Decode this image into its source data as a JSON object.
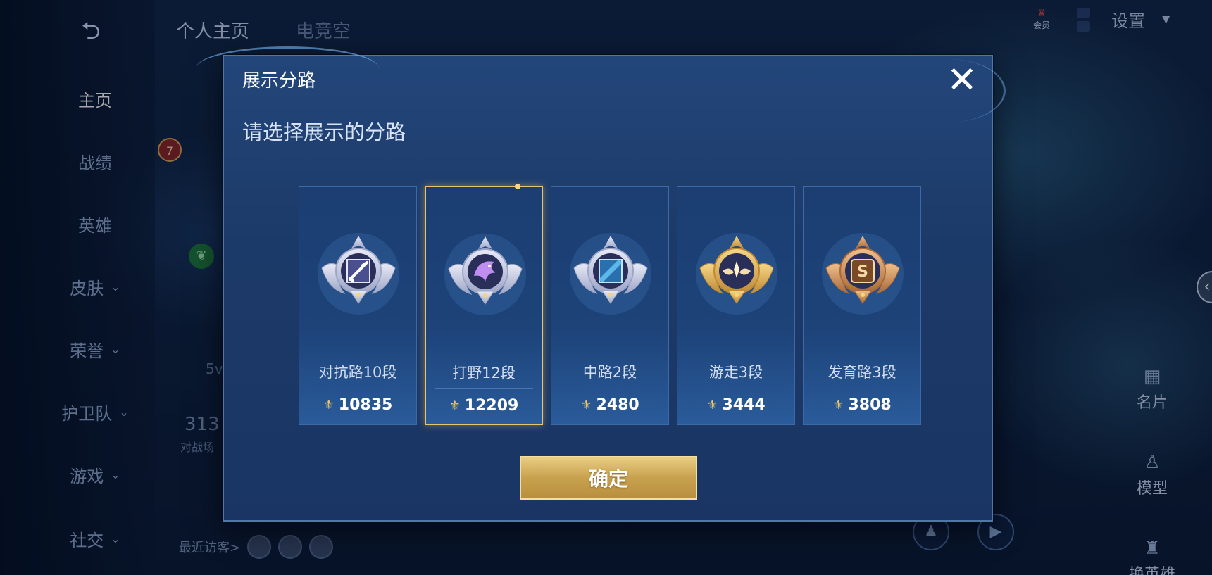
{
  "background": {
    "back_icon": "back-arrow-icon",
    "tabs": [
      "个人主页",
      "电竞空"
    ],
    "nav": [
      {
        "label": "主页",
        "has_chevron": false,
        "active": true
      },
      {
        "label": "战绩",
        "has_chevron": false
      },
      {
        "label": "英雄",
        "has_chevron": false
      },
      {
        "label": "皮肤",
        "has_chevron": true
      },
      {
        "label": "荣誉",
        "has_chevron": true
      },
      {
        "label": "护卫队",
        "has_chevron": true
      },
      {
        "label": "游戏",
        "has_chevron": true
      },
      {
        "label": "社交",
        "has_chevron": true
      }
    ],
    "member_label": "会员",
    "level_badge": "7",
    "mode_text": "5v",
    "match_count": "313",
    "match_label": "对战场",
    "settings_label": "设置",
    "visitors_label": "最近访客>",
    "right_tools": [
      "名片",
      "模型",
      "换英雄"
    ]
  },
  "dialog": {
    "title": "展示分路",
    "subtitle": "请选择展示的分路",
    "close_icon": "close-icon",
    "confirm_label": "确定",
    "selected_index": 1,
    "lanes": [
      {
        "name": "对抗路10段",
        "score": "10835",
        "medal": "sword-medal",
        "tier": "silver",
        "accent": "#a9a7e6"
      },
      {
        "name": "打野12段",
        "score": "12209",
        "medal": "dragon-medal",
        "tier": "silver",
        "accent": "#c08df0"
      },
      {
        "name": "中路2段",
        "score": "2480",
        "medal": "staff-medal",
        "tier": "silver",
        "accent": "#5bb8e8"
      },
      {
        "name": "游走3段",
        "score": "3444",
        "medal": "wings-medal",
        "tier": "gold",
        "accent": "#e7b865"
      },
      {
        "name": "发育路3段",
        "score": "3808",
        "medal": "coin-medal",
        "tier": "bronze",
        "accent": "#d69a5c"
      }
    ]
  }
}
